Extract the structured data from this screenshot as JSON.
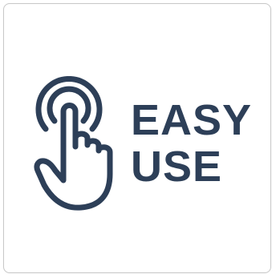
{
  "badge": {
    "line1": "EASY",
    "line2": "USE",
    "icon": "tap-hand-icon",
    "color": "#2d3f58"
  }
}
